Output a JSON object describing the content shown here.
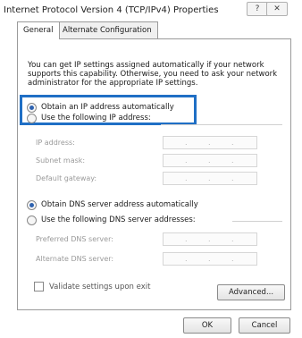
{
  "window": {
    "title": "Internet Protocol Version 4 (TCP/IPv4) Properties",
    "help_label": "?",
    "close_label": "✕"
  },
  "tabs": [
    {
      "label": "General",
      "active": true
    },
    {
      "label": "Alternate Configuration",
      "active": false
    }
  ],
  "description": "You can get IP settings assigned automatically if your network supports this capability. Otherwise, you need to ask your network administrator for the appropriate IP settings.",
  "ip": {
    "auto_label": "Obtain an IP address automatically",
    "auto_selected": true,
    "manual_label": "Use the following IP address:",
    "fields": [
      {
        "label": "IP address:",
        "value": ". . ."
      },
      {
        "label": "Subnet mask:",
        "value": ". . ."
      },
      {
        "label": "Default gateway:",
        "value": ". . ."
      }
    ]
  },
  "dns": {
    "auto_label": "Obtain DNS server address automatically",
    "auto_selected": true,
    "manual_label": "Use the following DNS server addresses:",
    "fields": [
      {
        "label": "Preferred DNS server:",
        "value": ". . ."
      },
      {
        "label": "Alternate DNS server:",
        "value": ". . ."
      }
    ]
  },
  "validate_label": "Validate settings upon exit",
  "validate_checked": false,
  "buttons": {
    "advanced": "Advanced...",
    "ok": "OK",
    "cancel": "Cancel"
  },
  "colors": {
    "highlight_border": "#1f6fc5",
    "radio_dot": "#2f63b0"
  }
}
